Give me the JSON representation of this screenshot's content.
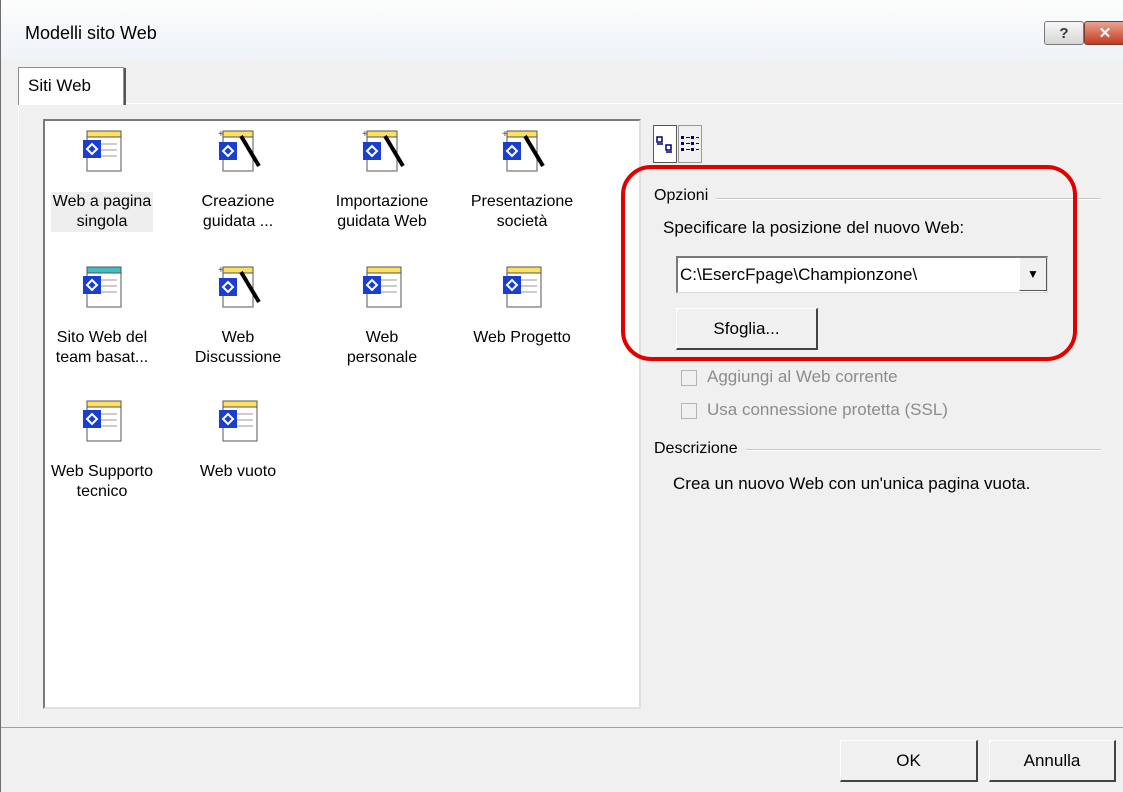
{
  "window": {
    "title": "Modelli sito Web",
    "help_label": "?",
    "close_label": "✕"
  },
  "tabs": [
    {
      "label": "Siti Web"
    }
  ],
  "templates": [
    {
      "label_line1": "Web a pagina",
      "label_line2": "singola",
      "icon": "page-icon"
    },
    {
      "label_line1": "Creazione",
      "label_line2": "guidata ...",
      "icon": "wizard-icon"
    },
    {
      "label_line1": "Importazione",
      "label_line2": "guidata Web",
      "icon": "wizard-icon"
    },
    {
      "label_line1": "Presentazione",
      "label_line2": "società",
      "icon": "wizard-icon"
    },
    {
      "label_line1": "Sito Web del",
      "label_line2": "team basat...",
      "icon": "team-page-icon"
    },
    {
      "label_line1": "Web",
      "label_line2": "Discussione",
      "icon": "wizard-icon"
    },
    {
      "label_line1": "Web",
      "label_line2": "personale",
      "icon": "page-icon"
    },
    {
      "label_line1": "Web Progetto",
      "label_line2": "",
      "icon": "page-icon"
    },
    {
      "label_line1": "Web Supporto",
      "label_line2": "tecnico",
      "icon": "page-icon"
    },
    {
      "label_line1": "Web vuoto",
      "label_line2": "",
      "icon": "page-icon"
    }
  ],
  "options": {
    "group_label": "Opzioni",
    "location_label": "Specificare la posizione del nuovo Web:",
    "location_value": "C:\\EsercFpage\\Championzone\\",
    "browse_label": "Sfoglia...",
    "add_to_current_label": "Aggiungi al Web corrente",
    "ssl_label": "Usa connessione protetta (SSL)"
  },
  "description": {
    "group_label": "Descrizione",
    "text": "Crea un nuovo Web con un'unica pagina vuota."
  },
  "buttons": {
    "ok_label": "OK",
    "cancel_label": "Annulla"
  },
  "colors": {
    "highlight": "#e00000",
    "icon_blue": "#1a3fd0"
  }
}
